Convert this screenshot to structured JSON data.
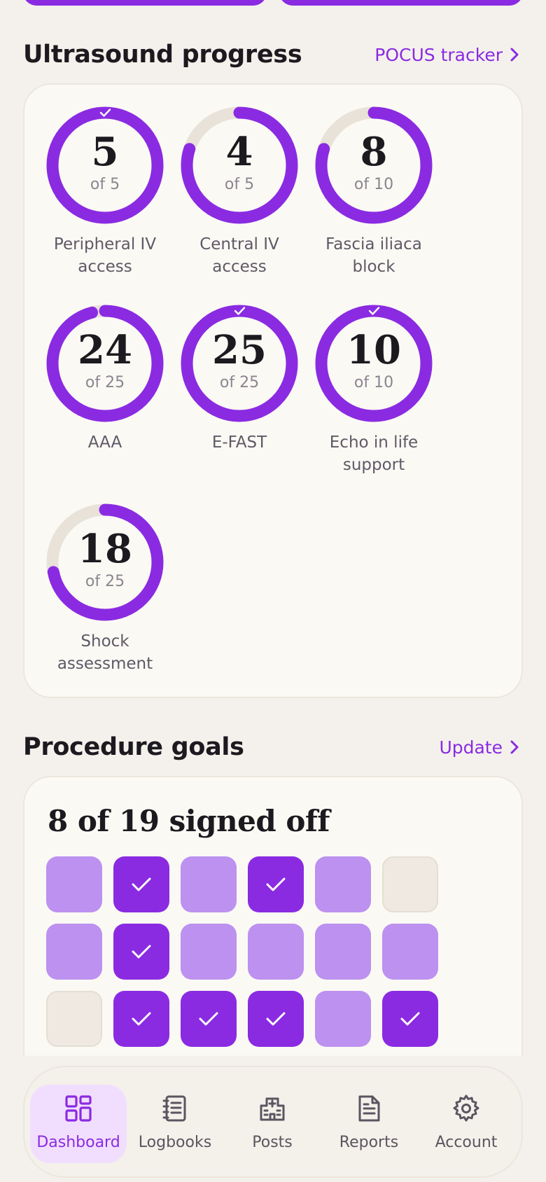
{
  "ultrasound": {
    "title": "Ultrasound progress",
    "link_label": "POCUS tracker",
    "rings": [
      {
        "count": "5",
        "of": "of 5",
        "label": "Peripheral IV access",
        "done": 5,
        "total": 5
      },
      {
        "count": "4",
        "of": "of 5",
        "label": "Central IV access",
        "done": 4,
        "total": 5
      },
      {
        "count": "8",
        "of": "of 10",
        "label": "Fascia iliaca block",
        "done": 8,
        "total": 10
      },
      {
        "count": "24",
        "of": "of 25",
        "label": "AAA",
        "done": 24,
        "total": 25
      },
      {
        "count": "25",
        "of": "of 25",
        "label": "E-FAST",
        "done": 25,
        "total": 25
      },
      {
        "count": "10",
        "of": "of 10",
        "label": "Echo in life support",
        "done": 10,
        "total": 10
      },
      {
        "count": "18",
        "of": "of 25",
        "label": "Shock assessment",
        "done": 18,
        "total": 25
      }
    ]
  },
  "procedures": {
    "title": "Procedure goals",
    "link_label": "Update",
    "summary": "8 of 19 signed off",
    "goals": [
      "pending",
      "done",
      "pending",
      "done",
      "pending",
      "empty",
      "pending",
      "done",
      "pending",
      "pending",
      "pending",
      "pending",
      "empty",
      "done",
      "done",
      "done",
      "pending",
      "done"
    ]
  },
  "nav": {
    "items": [
      {
        "label": "Dashboard",
        "icon": "dashboard-icon",
        "active": true
      },
      {
        "label": "Logbooks",
        "icon": "logbook-icon",
        "active": false
      },
      {
        "label": "Posts",
        "icon": "hospital-icon",
        "active": false
      },
      {
        "label": "Reports",
        "icon": "report-icon",
        "active": false
      },
      {
        "label": "Account",
        "icon": "gear-icon",
        "active": false
      }
    ]
  },
  "colors": {
    "accent": "#8a2be2",
    "pending": "#bc91f0",
    "track": "#e8e2d8",
    "background": "#f4f1ec"
  }
}
